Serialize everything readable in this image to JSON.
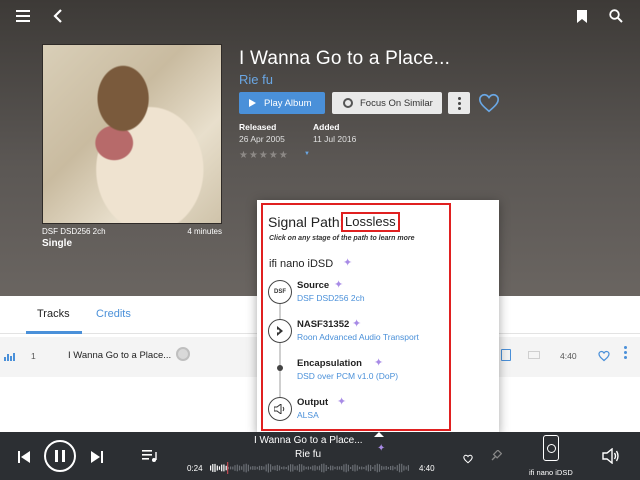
{
  "album": {
    "title": "I Wanna Go to a Place...",
    "artist": "Rie fu",
    "format": "DSF DSD256 2ch",
    "duration": "4 minutes",
    "kind": "Single",
    "released_label": "Released",
    "released_value": "26 Apr 2005",
    "added_label": "Added",
    "added_value": "11 Jul 2016",
    "rating_stars": "★★★★★",
    "rating_caret": "▼",
    "play_label": "Play Album",
    "focus_label": "Focus On Similar"
  },
  "tabs": [
    {
      "label": "Tracks",
      "active": true
    },
    {
      "label": "Credits",
      "active": false
    }
  ],
  "track": {
    "number": "1",
    "title": "I Wanna Go to a Place...",
    "duration": "4:40"
  },
  "signal_path": {
    "title": "Signal Path:",
    "quality": "Lossless",
    "hint": "Click on any stage of the path to learn more",
    "device": "ifi nano iDSD",
    "stages": [
      {
        "name": "Source",
        "detail": "DSF DSD256 2ch",
        "icon": "dsf-icon",
        "icon_text": "DSF"
      },
      {
        "name": "NASF31352",
        "detail": "Roon Advanced Audio Transport",
        "icon": "roon-icon"
      },
      {
        "name": "Encapsulation",
        "detail": "DSD over PCM v1.0 (DoP)",
        "icon": "dot-node"
      },
      {
        "name": "Output",
        "detail": "ALSA",
        "icon": "speaker-icon"
      }
    ]
  },
  "player": {
    "title": "I Wanna Go to a Place...",
    "artist": "Rie fu",
    "elapsed": "0:24",
    "total": "4:40",
    "progress": 0.086,
    "device": "ifi nano iDSD"
  },
  "colors": {
    "accent": "#4a90d9",
    "highlight_box": "#e02020",
    "sparkle": "#a88be6",
    "player_bg": "#2c2f33"
  }
}
